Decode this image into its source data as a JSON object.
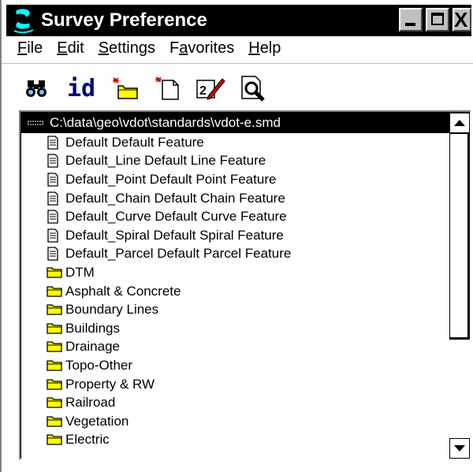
{
  "window": {
    "title": "Survey Preference",
    "close_glyph": "X"
  },
  "menu": [
    {
      "label": "File",
      "underline": "F",
      "rest": "ile"
    },
    {
      "label": "Edit",
      "underline": "E",
      "rest": "dit"
    },
    {
      "label": "Settings",
      "underline": "S",
      "rest": "ettings"
    },
    {
      "label": "Favorites",
      "pre": "F",
      "underline": "a",
      "rest": "vorites"
    },
    {
      "label": "Help",
      "underline": "H",
      "rest": "elp"
    }
  ],
  "toolbar": {
    "find_icon": "binoculars-icon",
    "id_label": "id",
    "new_category_icon": "new-folder-icon",
    "new_feature_icon": "new-document-icon",
    "edit_icon": "edit-icon",
    "preview_icon": "preview-icon"
  },
  "tree": {
    "root": "C:\\data\\geo\\vdot\\standards\\vdot-e.smd",
    "items": [
      {
        "type": "feature",
        "label": "Default  Default Feature"
      },
      {
        "type": "feature",
        "label": "Default_Line Default Line Feature"
      },
      {
        "type": "feature",
        "label": "Default_Point  Default Point Feature"
      },
      {
        "type": "feature",
        "label": "Default_Chain Default Chain Feature"
      },
      {
        "type": "feature",
        "label": "Default_Curve Default Curve Feature"
      },
      {
        "type": "feature",
        "label": "Default_Spiral Default Spiral Feature"
      },
      {
        "type": "feature",
        "label": "Default_Parcel Default Parcel Feature"
      },
      {
        "type": "folder",
        "label": "DTM"
      },
      {
        "type": "folder",
        "label": "Asphalt & Concrete"
      },
      {
        "type": "folder",
        "label": "Boundary Lines"
      },
      {
        "type": "folder",
        "label": "Buildings"
      },
      {
        "type": "folder",
        "label": "Drainage"
      },
      {
        "type": "folder",
        "label": "Topo-Other"
      },
      {
        "type": "folder",
        "label": "Property & RW"
      },
      {
        "type": "folder",
        "label": "Railroad"
      },
      {
        "type": "folder",
        "label": "Vegetation"
      },
      {
        "type": "folder",
        "label": "Electric"
      }
    ]
  },
  "colors": {
    "folder": "#ffff00",
    "selection": "#000000",
    "accent_red": "#cc0000"
  }
}
